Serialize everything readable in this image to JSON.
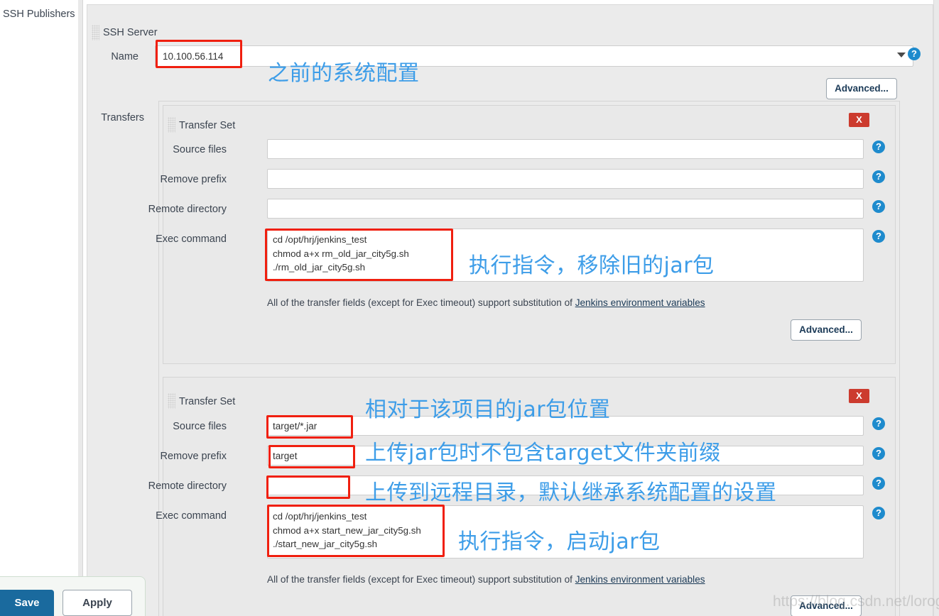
{
  "sidebar": {
    "label": "SSH Publishers"
  },
  "server": {
    "section_title": "SSH Server",
    "name_label": "Name",
    "name_value": "10.100.56.114",
    "transfers_label": "Transfers",
    "advanced_label": "Advanced..."
  },
  "icons": {
    "help": "?",
    "delete": "X"
  },
  "transfer_sets": [
    {
      "title": "Transfer Set",
      "source_files_label": "Source files",
      "source_files_value": "",
      "remove_prefix_label": "Remove prefix",
      "remove_prefix_value": "",
      "remote_directory_label": "Remote directory",
      "remote_directory_value": "",
      "exec_command_label": "Exec command",
      "exec_command_value": "cd /opt/hrj/jenkins_test\nchmod a+x rm_old_jar_city5g.sh\n./rm_old_jar_city5g.sh",
      "helper_prefix": "All of the transfer fields (except for Exec timeout) support substitution of ",
      "helper_link": "Jenkins environment variables",
      "advanced_label": "Advanced..."
    },
    {
      "title": "Transfer Set",
      "source_files_label": "Source files",
      "source_files_value": "target/*.jar",
      "remove_prefix_label": "Remove prefix",
      "remove_prefix_value": "target",
      "remote_directory_label": "Remote directory",
      "remote_directory_value": "",
      "exec_command_label": "Exec command",
      "exec_command_value": "cd /opt/hrj/jenkins_test\nchmod a+x start_new_jar_city5g.sh\n./start_new_jar_city5g.sh",
      "helper_prefix": "All of the transfer fields (except for Exec timeout) support substitution of ",
      "helper_link": "Jenkins environment variables",
      "advanced_label": "Advanced..."
    }
  ],
  "annotations": [
    {
      "text": "之前的系统配置"
    },
    {
      "text": "执行指令，移除旧的jar包"
    },
    {
      "text": "相对于该项目的jar包位置"
    },
    {
      "text": "上传jar包时不包含target文件夹前缀"
    },
    {
      "text": "上传到远程目录，默认继承系统配置的设置"
    },
    {
      "text": "执行指令，启动jar包"
    }
  ],
  "footer": {
    "save_label": "Save",
    "apply_label": "Apply"
  },
  "watermark": "https://blog.csdn.net/lorogy",
  "colors": {
    "annotation": "#3d9de8",
    "highlight_box": "#f01f0f",
    "help_icon": "#1e8bcd",
    "delete_button": "#cc3b2e",
    "save_button": "#1a6a9e"
  }
}
